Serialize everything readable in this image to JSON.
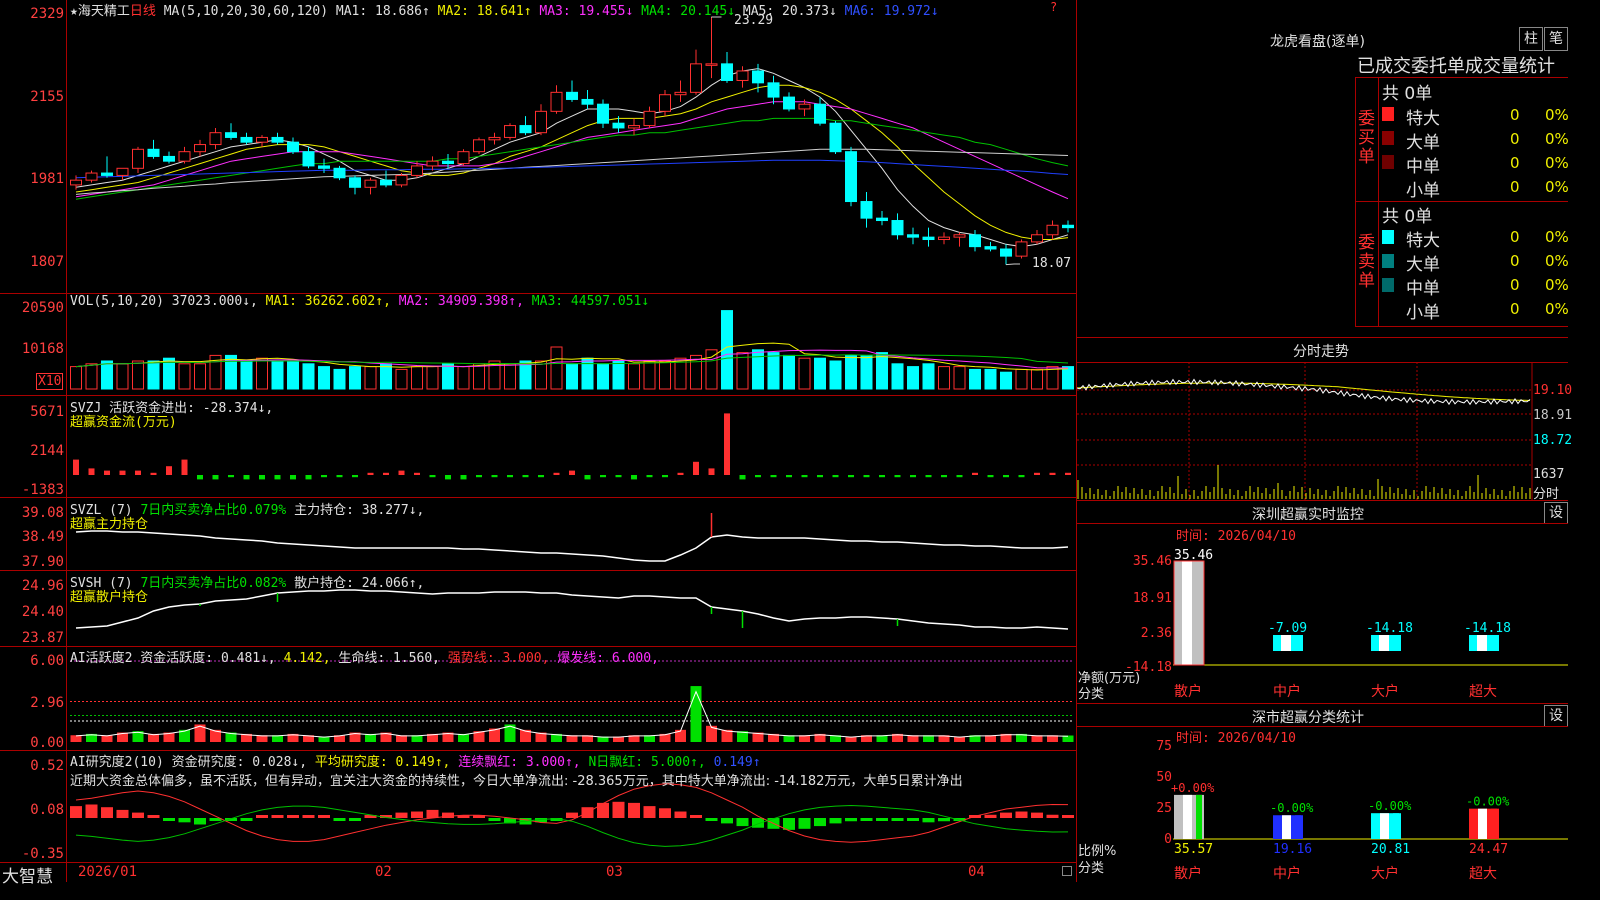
{
  "stock": {
    "star": "★",
    "name": "海天精工",
    "period": "日线"
  },
  "ma_line": {
    "label": "MA(5,10,20,30,60,120)",
    "ma1": "MA1: 18.686↑",
    "ma2": "MA2: 18.641↑",
    "ma3": "MA3: 19.455↓",
    "ma4": "MA4: 20.145↓",
    "ma5": "MA5: 20.373↓",
    "ma6": "MA6: 19.972↓"
  },
  "price_axis": [
    "2329",
    "2155",
    "1981",
    "1807"
  ],
  "price_high": "23.29",
  "price_low": "18.07",
  "vol": {
    "label": "VOL(5,10,20)",
    "v": "37023.000↓,",
    "ma1": "MA1: 36262.602↑,",
    "ma2": "MA2: 34909.398↑,",
    "ma3": "MA3: 44597.051↓",
    "axis": [
      "20590",
      "10168"
    ],
    "unit": "X10"
  },
  "svzj": {
    "label": "SVZJ  活跃资金进出: -28.374↓,",
    "sub": "超赢资金流(万元)",
    "axis": [
      "5671",
      "2144",
      "-1383"
    ]
  },
  "svzl": {
    "label": "SVZL (7)",
    "ratio": "7日内买卖净占比0.079%",
    "hold": "主力持仓: 38.277↓,",
    "sub": "超赢主力持仓",
    "axis": [
      "39.08",
      "38.49",
      "37.90"
    ]
  },
  "svsh": {
    "label": "SVSH (7)",
    "ratio": "7日内买卖净占比0.082%",
    "hold": "散户持仓: 24.066↑,",
    "sub": "超赢散户持仓",
    "axis": [
      "24.96",
      "24.40",
      "23.87"
    ]
  },
  "ai1": {
    "a": "AI活跃度2 资金活跃度: 0.481↓,",
    "b": "4.142,",
    "c": "生命线: 1.560,",
    "d": "强势线: 3.000,",
    "e": "爆发线: 6.000,",
    "axis": [
      "6.00",
      "2.96",
      "0.00"
    ]
  },
  "ai2": {
    "a": "AI研究度2(10)",
    "b": "资金研究度: 0.028↓,",
    "c": "平均研究度: 0.149↑,",
    "d": "连续飘红: 3.000↑,",
    "e": "N日飘红: 5.000↑,",
    "f": "0.149↑",
    "axis": [
      "0.52",
      "0.08",
      "-0.35"
    ],
    "comment": "近期大资金总体偏多，虽不活跃，但有异动，宜关注大资金的持续性，今日大单净流出: -28.365万元，其中特大单净流出: -14.182万元，大单5日累计净出"
  },
  "xaxis": {
    "brand": "大智慧",
    "labels": [
      "2026/01",
      "02",
      "03",
      "04"
    ]
  },
  "right": {
    "title": "龙虎看盘(逐单)",
    "btn1": "柱",
    "btn2": "笔",
    "header": "已成交委托单成交量统计",
    "buy_label": "委买单",
    "sell_label": "委卖单",
    "buy_total": "共 0单",
    "sell_total": "共 0单",
    "buy_rows": [
      {
        "name": "特大",
        "val": "0",
        "pct": "0%"
      },
      {
        "name": "大单",
        "val": "0",
        "pct": "0%"
      },
      {
        "name": "中单",
        "val": "0",
        "pct": "0%"
      },
      {
        "name": "小单",
        "val": "0",
        "pct": "0%"
      }
    ],
    "sell_rows": [
      {
        "name": "特大",
        "val": "0",
        "pct": "0%"
      },
      {
        "name": "大单",
        "val": "0",
        "pct": "0%"
      },
      {
        "name": "中单",
        "val": "0",
        "pct": "0%"
      },
      {
        "name": "小单",
        "val": "0",
        "pct": "0%"
      }
    ],
    "intraday_title": "分时走势",
    "intraday_axis": [
      "19.10",
      "18.91",
      "18.72"
    ],
    "intraday_vol": [
      "1637",
      "分时"
    ],
    "monitor_title": "深圳超赢实时监控",
    "monitor_btn": "设",
    "monitor_time": "时间: 2026/04/10",
    "monitor_axis": [
      "35.46",
      "18.91",
      "2.36",
      "-14.18"
    ],
    "monitor_bars": [
      {
        "cat": "散户",
        "value": "35.46"
      },
      {
        "cat": "中户",
        "value": "-7.09"
      },
      {
        "cat": "大户",
        "value": "-14.18"
      },
      {
        "cat": "超大",
        "value": "-14.18"
      }
    ],
    "monitor_ylabel": "净额(万元)",
    "monitor_xlabel": "分类",
    "stats_title": "深市超赢分类统计",
    "stats_btn": "设",
    "stats_time": "时间: 2026/04/10",
    "stats_axis": [
      "75",
      "50",
      "25",
      "0"
    ],
    "stats_bars": [
      {
        "cat": "散户",
        "value": "35.57",
        "chg": "+0.00%"
      },
      {
        "cat": "中户",
        "value": "19.16",
        "chg": "-0.00%"
      },
      {
        "cat": "大户",
        "value": "20.81",
        "chg": "-0.00%"
      },
      {
        "cat": "超大",
        "value": "24.47",
        "chg": "-0.00%"
      }
    ],
    "stats_ylabel": "比例%",
    "stats_xlabel": "分类"
  },
  "colors": {
    "up": "#ff3030",
    "down": "#00ffff",
    "grid": "#aa0000"
  },
  "chart_data": {
    "type": "candlestick",
    "title": "海天精工 日线",
    "ylim": [
      17.5,
      23.6
    ],
    "x": [
      "2026/01",
      "02",
      "03",
      "04"
    ],
    "ohlc": [
      [
        19.75,
        19.95,
        19.65,
        19.85
      ],
      [
        19.85,
        20.05,
        19.8,
        20.0
      ],
      [
        20.0,
        20.35,
        19.9,
        19.95
      ],
      [
        19.95,
        20.1,
        19.85,
        20.1
      ],
      [
        20.1,
        20.55,
        20.0,
        20.5
      ],
      [
        20.5,
        20.7,
        20.3,
        20.35
      ],
      [
        20.35,
        20.45,
        20.2,
        20.25
      ],
      [
        20.25,
        20.55,
        20.2,
        20.45
      ],
      [
        20.45,
        20.7,
        20.35,
        20.6
      ],
      [
        20.6,
        20.95,
        20.5,
        20.85
      ],
      [
        20.85,
        21.05,
        20.7,
        20.75
      ],
      [
        20.75,
        20.85,
        20.6,
        20.65
      ],
      [
        20.65,
        20.8,
        20.55,
        20.75
      ],
      [
        20.75,
        20.85,
        20.6,
        20.65
      ],
      [
        20.65,
        20.75,
        20.4,
        20.45
      ],
      [
        20.45,
        20.55,
        20.1,
        20.15
      ],
      [
        20.15,
        20.3,
        20.0,
        20.1
      ],
      [
        20.1,
        20.15,
        19.85,
        19.9
      ],
      [
        19.9,
        19.95,
        19.55,
        19.7
      ],
      [
        19.7,
        19.9,
        19.55,
        19.85
      ],
      [
        19.85,
        20.05,
        19.7,
        19.75
      ],
      [
        19.75,
        20.0,
        19.7,
        19.95
      ],
      [
        19.95,
        20.25,
        19.9,
        20.15
      ],
      [
        20.15,
        20.35,
        20.05,
        20.25
      ],
      [
        20.25,
        20.4,
        20.1,
        20.2
      ],
      [
        20.2,
        20.5,
        20.15,
        20.45
      ],
      [
        20.45,
        20.75,
        20.4,
        20.7
      ],
      [
        20.7,
        20.85,
        20.6,
        20.75
      ],
      [
        20.75,
        21.05,
        20.7,
        21.0
      ],
      [
        21.0,
        21.2,
        20.8,
        20.85
      ],
      [
        20.85,
        21.45,
        20.8,
        21.3
      ],
      [
        21.3,
        21.85,
        21.25,
        21.7
      ],
      [
        21.7,
        21.95,
        21.5,
        21.55
      ],
      [
        21.55,
        21.75,
        21.35,
        21.45
      ],
      [
        21.45,
        21.55,
        20.95,
        21.05
      ],
      [
        21.05,
        21.2,
        20.85,
        20.95
      ],
      [
        20.95,
        21.15,
        20.8,
        21.0
      ],
      [
        21.0,
        21.4,
        20.95,
        21.3
      ],
      [
        21.3,
        21.75,
        21.2,
        21.65
      ],
      [
        21.65,
        21.95,
        21.5,
        21.7
      ],
      [
        21.7,
        22.6,
        21.65,
        22.3
      ],
      [
        22.3,
        23.29,
        22.0,
        22.3
      ],
      [
        22.3,
        22.55,
        21.9,
        21.95
      ],
      [
        21.95,
        22.25,
        21.8,
        22.15
      ],
      [
        22.15,
        22.3,
        21.7,
        21.9
      ],
      [
        21.9,
        22.05,
        21.45,
        21.6
      ],
      [
        21.6,
        21.7,
        21.3,
        21.35
      ],
      [
        21.35,
        21.55,
        21.2,
        21.45
      ],
      [
        21.45,
        21.6,
        21.0,
        21.05
      ],
      [
        21.05,
        21.1,
        20.4,
        20.45
      ],
      [
        20.45,
        20.55,
        19.3,
        19.4
      ],
      [
        19.4,
        19.6,
        18.85,
        19.05
      ],
      [
        19.05,
        19.2,
        18.9,
        19.0
      ],
      [
        19.0,
        19.15,
        18.6,
        18.7
      ],
      [
        18.7,
        18.85,
        18.5,
        18.65
      ],
      [
        18.65,
        18.85,
        18.45,
        18.6
      ],
      [
        18.6,
        18.75,
        18.5,
        18.65
      ],
      [
        18.65,
        18.75,
        18.45,
        18.7
      ],
      [
        18.7,
        18.8,
        18.35,
        18.45
      ],
      [
        18.45,
        18.55,
        18.35,
        18.4
      ],
      [
        18.4,
        18.5,
        18.07,
        18.25
      ],
      [
        18.25,
        18.6,
        18.2,
        18.55
      ],
      [
        18.55,
        18.8,
        18.5,
        18.7
      ],
      [
        18.7,
        19.0,
        18.6,
        18.9
      ],
      [
        18.9,
        19.0,
        18.75,
        18.85
      ]
    ],
    "series": [
      {
        "name": "MA1",
        "values": [
          19.7,
          19.75,
          19.8,
          19.85,
          19.95,
          20.05,
          20.15,
          20.25,
          20.35,
          20.45,
          20.55,
          20.6,
          20.65,
          20.7,
          20.65,
          20.55,
          20.4,
          20.25,
          20.05,
          19.95,
          19.85,
          19.85,
          19.9,
          20.0,
          20.1,
          20.2,
          20.35,
          20.5,
          20.65,
          20.75,
          20.85,
          21.05,
          21.2,
          21.35,
          21.35,
          21.35,
          21.3,
          21.25,
          21.3,
          21.4,
          21.6,
          21.85,
          22.05,
          22.15,
          22.2,
          22.1,
          21.95,
          21.8,
          21.6,
          21.3,
          20.9,
          20.5,
          20.1,
          19.65,
          19.3,
          19.0,
          18.85,
          18.75,
          18.7,
          18.6,
          18.5,
          18.45,
          18.5,
          18.6,
          18.7
        ]
      },
      {
        "name": "MA2",
        "values": [
          19.6,
          19.65,
          19.7,
          19.75,
          19.8,
          19.9,
          20.0,
          20.1,
          20.2,
          20.3,
          20.4,
          20.5,
          20.55,
          20.6,
          20.6,
          20.6,
          20.55,
          20.45,
          20.35,
          20.25,
          20.15,
          20.05,
          20.0,
          19.95,
          19.95,
          20.0,
          20.1,
          20.2,
          20.35,
          20.45,
          20.55,
          20.7,
          20.85,
          21.0,
          21.1,
          21.15,
          21.15,
          21.15,
          21.2,
          21.25,
          21.35,
          21.5,
          21.6,
          21.7,
          21.8,
          21.85,
          21.85,
          21.8,
          21.7,
          21.55,
          21.35,
          21.1,
          20.85,
          20.55,
          20.2,
          19.9,
          19.6,
          19.35,
          19.1,
          18.9,
          18.75,
          18.65,
          18.6,
          18.6,
          18.64
        ]
      },
      {
        "name": "MA3",
        "values": [
          19.5,
          19.55,
          19.6,
          19.65,
          19.7,
          19.75,
          19.85,
          19.95,
          20.05,
          20.15,
          20.25,
          20.3,
          20.35,
          20.4,
          20.45,
          20.45,
          20.45,
          20.45,
          20.4,
          20.35,
          20.3,
          20.25,
          20.2,
          20.15,
          20.15,
          20.15,
          20.15,
          20.2,
          20.25,
          20.35,
          20.45,
          20.55,
          20.65,
          20.75,
          20.8,
          20.85,
          20.9,
          20.95,
          21.0,
          21.05,
          21.15,
          21.25,
          21.35,
          21.4,
          21.45,
          21.5,
          21.5,
          21.5,
          21.45,
          21.4,
          21.35,
          21.25,
          21.15,
          21.05,
          20.95,
          20.8,
          20.65,
          20.5,
          20.35,
          20.2,
          20.05,
          19.9,
          19.75,
          19.6,
          19.46
        ]
      },
      {
        "name": "MA4",
        "values": [
          19.45,
          19.5,
          19.55,
          19.6,
          19.65,
          19.7,
          19.75,
          19.8,
          19.85,
          19.9,
          19.95,
          20.0,
          20.05,
          20.1,
          20.15,
          20.2,
          20.2,
          20.25,
          20.25,
          20.25,
          20.25,
          20.25,
          20.25,
          20.25,
          20.3,
          20.3,
          20.35,
          20.4,
          20.45,
          20.5,
          20.55,
          20.6,
          20.65,
          20.7,
          20.75,
          20.8,
          20.8,
          20.85,
          20.85,
          20.9,
          20.95,
          21.0,
          21.05,
          21.1,
          21.1,
          21.15,
          21.15,
          21.15,
          21.15,
          21.1,
          21.1,
          21.05,
          21.0,
          20.95,
          20.9,
          20.85,
          20.8,
          20.75,
          20.65,
          20.6,
          20.5,
          20.4,
          20.3,
          20.22,
          20.15
        ]
      },
      {
        "name": "MA5",
        "values": [
          19.55,
          19.58,
          19.6,
          19.63,
          19.65,
          19.68,
          19.7,
          19.72,
          19.75,
          19.77,
          19.8,
          19.82,
          19.84,
          19.86,
          19.88,
          19.9,
          19.92,
          19.93,
          19.94,
          19.95,
          19.96,
          19.97,
          19.98,
          20.0,
          20.02,
          20.04,
          20.06,
          20.08,
          20.1,
          20.12,
          20.14,
          20.16,
          20.18,
          20.2,
          20.22,
          20.24,
          20.26,
          20.28,
          20.3,
          20.32,
          20.34,
          20.36,
          20.38,
          20.4,
          20.42,
          20.44,
          20.46,
          20.48,
          20.5,
          20.5,
          20.5,
          20.5,
          20.49,
          20.48,
          20.47,
          20.46,
          20.45,
          20.44,
          20.43,
          20.42,
          20.41,
          20.4,
          20.39,
          20.38,
          20.37
        ]
      },
      {
        "name": "MA6",
        "values": [
          19.9,
          19.91,
          19.92,
          19.93,
          19.94,
          19.95,
          19.96,
          19.97,
          19.98,
          19.99,
          20.0,
          20.01,
          20.02,
          20.03,
          20.04,
          20.05,
          20.06,
          20.06,
          20.06,
          20.07,
          20.07,
          20.07,
          20.08,
          20.08,
          20.08,
          20.09,
          20.09,
          20.1,
          20.1,
          20.11,
          20.12,
          20.13,
          20.14,
          20.15,
          20.16,
          20.17,
          20.18,
          20.19,
          20.2,
          20.21,
          20.22,
          20.23,
          20.24,
          20.25,
          20.26,
          20.27,
          20.27,
          20.27,
          20.27,
          20.26,
          20.25,
          20.24,
          20.22,
          20.2,
          20.18,
          20.16,
          20.14,
          20.12,
          20.1,
          20.08,
          20.06,
          20.04,
          20.02,
          19.99,
          19.97
        ]
      }
    ],
    "volume": [
      8,
      9,
      10,
      9,
      10,
      10,
      11,
      9,
      9,
      12,
      12,
      10,
      11,
      10,
      10,
      9,
      8,
      7,
      8,
      8,
      9,
      7,
      8,
      8,
      9,
      8,
      9,
      10,
      9,
      10,
      10,
      15,
      9,
      11,
      9,
      10,
      9,
      10,
      10,
      11,
      12,
      14,
      28,
      13,
      14,
      13,
      12,
      11,
      11,
      10,
      12,
      12,
      13,
      9,
      8,
      9,
      8,
      8,
      7,
      7,
      6,
      7,
      7,
      8,
      8
    ],
    "svzj": [
      7,
      3,
      2,
      2,
      2,
      1,
      4,
      7,
      -2,
      -2,
      -1,
      -2,
      -2,
      -2,
      -2,
      -2,
      -1,
      -1,
      -1,
      1,
      1,
      2,
      1,
      -1,
      -2,
      -2,
      -1,
      -1,
      -1,
      -1,
      -1,
      1,
      2,
      -2,
      -1,
      -1,
      -2,
      -1,
      -1,
      1,
      6,
      3,
      28,
      -2,
      -1,
      -1,
      -1,
      -1,
      -1,
      -1,
      -1,
      -1,
      -1,
      -1,
      -1,
      -1,
      -1,
      -1,
      1,
      -1,
      -1,
      -1,
      1,
      1,
      1
    ],
    "activity": [
      0.5,
      0.6,
      0.5,
      0.7,
      0.8,
      0.6,
      0.7,
      0.9,
      1.3,
      0.9,
      0.7,
      0.6,
      0.5,
      0.5,
      0.6,
      0.5,
      0.4,
      0.5,
      0.7,
      0.6,
      0.7,
      0.5,
      0.5,
      0.6,
      0.7,
      0.6,
      0.8,
      1.0,
      1.3,
      0.9,
      0.7,
      0.6,
      0.5,
      0.5,
      0.4,
      0.4,
      0.5,
      0.5,
      0.6,
      0.9,
      4.142,
      1.2,
      0.9,
      0.8,
      0.7,
      0.6,
      0.5,
      0.5,
      0.6,
      0.5,
      0.4,
      0.5,
      0.5,
      0.6,
      0.5,
      0.5,
      0.5,
      0.4,
      0.5,
      0.5,
      0.6,
      0.6,
      0.5,
      0.5,
      0.481
    ],
    "research": [
      0.22,
      0.25,
      0.2,
      0.15,
      0.1,
      0.0,
      -0.05,
      -0.08,
      -0.12,
      -0.05,
      -0.03,
      -0.04,
      0.0,
      0.02,
      0.04,
      0.03,
      0.02,
      -0.02,
      -0.05,
      0.0,
      0.05,
      0.1,
      0.12,
      0.15,
      0.1,
      0.05,
      0.0,
      -0.05,
      -0.1,
      -0.12,
      -0.08,
      -0.02,
      0.1,
      0.2,
      0.28,
      0.3,
      0.28,
      0.22,
      0.18,
      0.12,
      0.05,
      -0.05,
      -0.1,
      -0.15,
      -0.18,
      -0.2,
      -0.22,
      -0.2,
      -0.15,
      -0.1,
      -0.06,
      -0.05,
      -0.04,
      -0.03,
      -0.05,
      -0.08,
      -0.06,
      -0.03,
      0.02,
      0.06,
      0.1,
      0.12,
      0.1,
      0.06,
      0.028
    ],
    "research_avg": [
      0.2,
      0.22,
      0.25,
      0.28,
      0.3,
      0.28,
      0.24,
      0.18,
      0.1,
      0.02,
      -0.06,
      -0.14,
      -0.2,
      -0.24,
      -0.26,
      -0.26,
      -0.24,
      -0.2,
      -0.16,
      -0.12,
      -0.08,
      -0.05,
      -0.02,
      0.0,
      0.02,
      0.03,
      0.03,
      0.02,
      0.0,
      -0.02,
      -0.05,
      -0.06,
      -0.02,
      0.06,
      0.16,
      0.25,
      0.32,
      0.36,
      0.38,
      0.37,
      0.34,
      0.28,
      0.2,
      0.12,
      0.02,
      -0.06,
      -0.14,
      -0.2,
      -0.24,
      -0.26,
      -0.27,
      -0.26,
      -0.24,
      -0.22,
      -0.2,
      -0.16,
      -0.1,
      -0.04,
      0.02,
      0.06,
      0.1,
      0.12,
      0.14,
      0.15,
      0.149
    ]
  }
}
